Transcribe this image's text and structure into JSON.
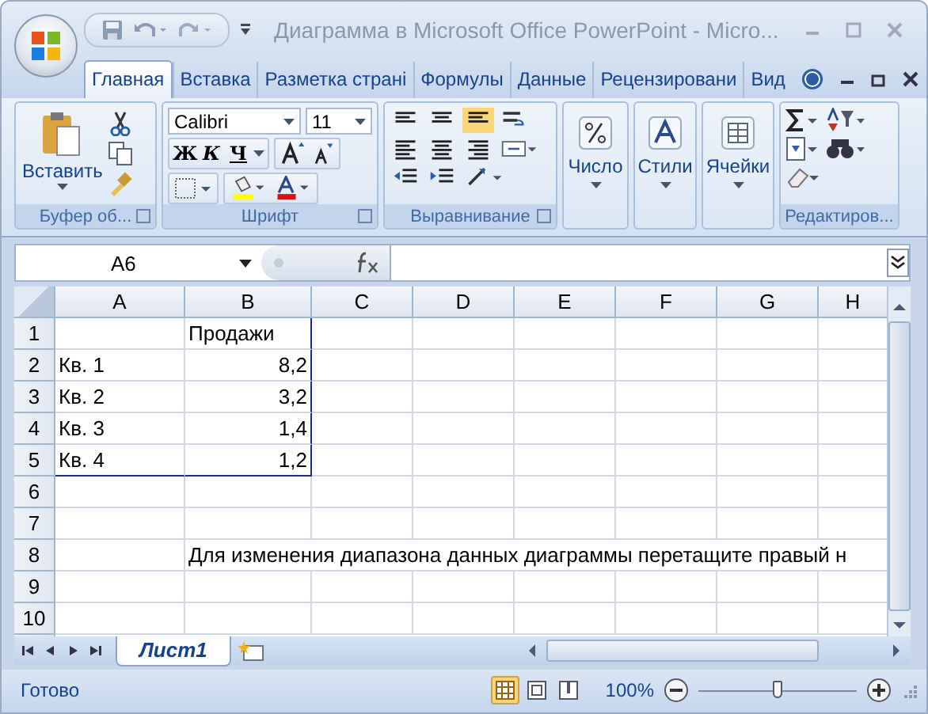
{
  "window": {
    "title": "Диаграмма в Microsoft Office PowerPoint - Micro..."
  },
  "tabs": [
    {
      "label": "Главная",
      "selected": true
    },
    {
      "label": "Вставка",
      "selected": false
    },
    {
      "label": "Разметка страні",
      "selected": false
    },
    {
      "label": "Формулы",
      "selected": false
    },
    {
      "label": "Данные",
      "selected": false
    },
    {
      "label": "Рецензировани",
      "selected": false
    },
    {
      "label": "Вид",
      "selected": false
    }
  ],
  "ribbon": {
    "clipboard": {
      "paste": "Вставить",
      "group_label": "Буфер об..."
    },
    "font": {
      "name": "Calibri",
      "size": "11",
      "bold": "Ж",
      "italic": "К",
      "underline": "Ч",
      "group_label": "Шрифт"
    },
    "alignment": {
      "group_label": "Выравнивание"
    },
    "number": {
      "label": "Число"
    },
    "styles": {
      "label": "Стили"
    },
    "cells": {
      "label": "Ячейки"
    },
    "editing": {
      "group_label": "Редактиров..."
    }
  },
  "formula_bar": {
    "name_box": "A6"
  },
  "columns": [
    "A",
    "B",
    "C",
    "D",
    "E",
    "F",
    "G",
    "H"
  ],
  "rows": [
    {
      "number": "1",
      "cells": [
        {
          "kind": "empty"
        },
        {
          "kind": "text",
          "text": "Продажи"
        }
      ]
    },
    {
      "number": "2",
      "cells": [
        {
          "kind": "text",
          "text": "Кв. 1"
        },
        {
          "kind": "number",
          "text": "8,2"
        }
      ]
    },
    {
      "number": "3",
      "cells": [
        {
          "kind": "text",
          "text": "Кв. 2"
        },
        {
          "kind": "number",
          "text": "3,2"
        }
      ]
    },
    {
      "number": "4",
      "cells": [
        {
          "kind": "text",
          "text": "Кв. 3"
        },
        {
          "kind": "number",
          "text": "1,4"
        }
      ]
    },
    {
      "number": "5",
      "cells": [
        {
          "kind": "text",
          "text": "Кв. 4"
        },
        {
          "kind": "number",
          "text": "1,2"
        }
      ]
    },
    {
      "number": "6",
      "cells": []
    },
    {
      "number": "7",
      "cells": []
    },
    {
      "number": "8",
      "cells": [
        {
          "kind": "empty"
        },
        {
          "kind": "overflow",
          "text": "Для изменения диапазона данных диаграммы перетащите правый н"
        }
      ]
    },
    {
      "number": "9",
      "cells": []
    },
    {
      "number": "10",
      "cells": []
    }
  ],
  "sheet_tabs": [
    {
      "label": "Лист1",
      "selected": true
    }
  ],
  "status_bar": {
    "text": "Готово",
    "zoom": "100%",
    "zoom_slider": {
      "level": 0.5
    },
    "views": [
      {
        "kind": "normal",
        "selected": true
      },
      {
        "kind": "page_layout",
        "selected": false
      },
      {
        "kind": "page_break",
        "selected": false
      }
    ]
  }
}
